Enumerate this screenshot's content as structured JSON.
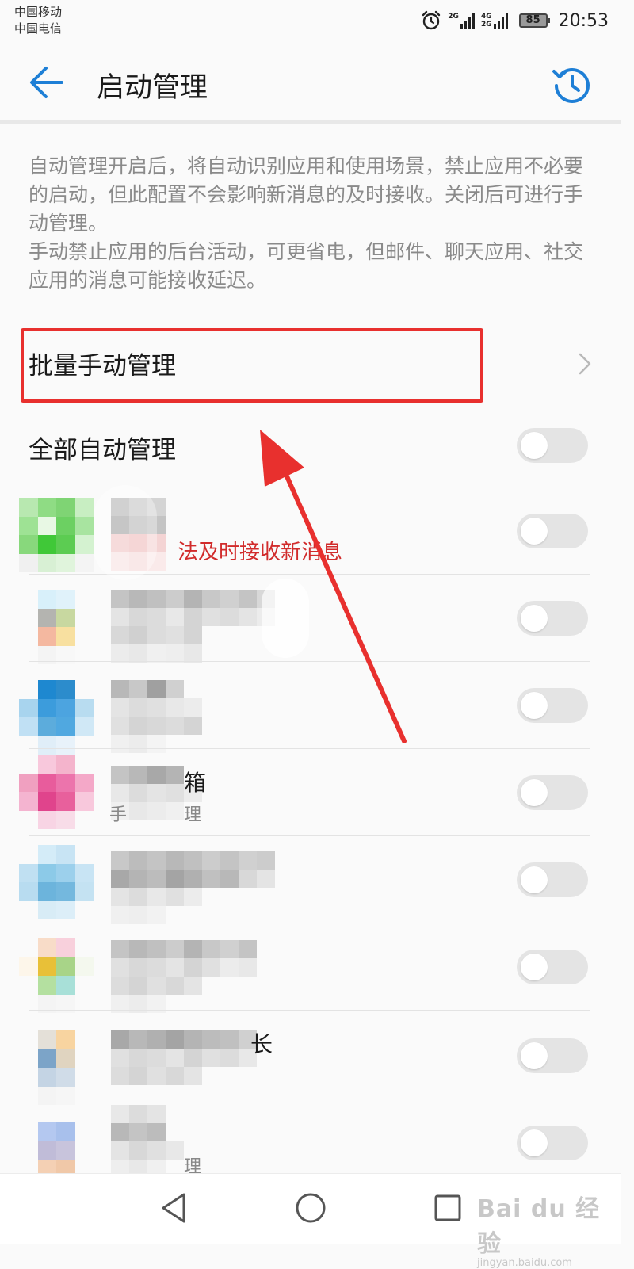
{
  "status_bar": {
    "carrier_1": "中国移动",
    "carrier_2": "中国电信",
    "network_1": "2G",
    "network_2_top": "4G",
    "network_2_bottom": "2G",
    "battery": "85",
    "time": "20:53",
    "icons": [
      "alarm-icon",
      "signal-icon",
      "battery-icon"
    ]
  },
  "header": {
    "title": "启动管理",
    "back_icon": "arrow-left-icon",
    "history_icon": "history-clock-icon"
  },
  "description": {
    "para_1": "自动管理开启后，将自动识别应用和使用场景，禁止应用不必要的启动，但此配置不会影响新消息的及时接收。关闭后可进行手动管理。",
    "para_2": "手动禁止应用的后台活动，可更省电，但邮件、聊天应用、社交应用的消息可能接收延迟。"
  },
  "rows": {
    "batch_manual": "批量手动管理",
    "all_auto": "全部自动管理"
  },
  "apps": {
    "warning_text": "法及时接收新消息",
    "frag_mailbox": "箱",
    "frag_4": "手",
    "frag_4b": "理",
    "frag_7": "长",
    "frag_8": "理"
  },
  "toggles": {
    "all_auto_on": false,
    "app_states": [
      false,
      false,
      false,
      false,
      false,
      false,
      false,
      false
    ]
  },
  "colors": {
    "accent": "#1e7fd6",
    "highlight": "#e8302e",
    "toggle_off": "#e4e4e4",
    "description_text": "#8a8a8a"
  },
  "nav": {
    "icons": [
      "back-triangle-icon",
      "home-circle-icon",
      "recents-square-icon"
    ]
  },
  "watermark": {
    "main": "Bai du 经验",
    "sub": "jingyan.baidu.com"
  }
}
